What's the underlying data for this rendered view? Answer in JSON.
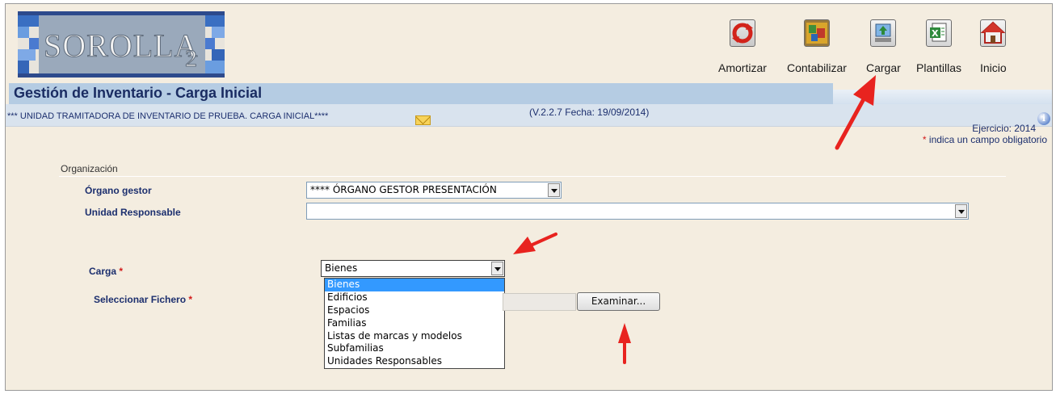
{
  "logo": {
    "text": "SOROLLA",
    "subscript": "2"
  },
  "toolbar": {
    "items": [
      {
        "label": "Amortizar",
        "icon": "refresh-icon"
      },
      {
        "label": "Contabilizar",
        "icon": "accounting-icon"
      },
      {
        "label": "Cargar",
        "icon": "upload-icon"
      },
      {
        "label": "Plantillas",
        "icon": "excel-template-icon"
      },
      {
        "label": "Inicio",
        "icon": "home-icon"
      }
    ]
  },
  "header": {
    "title": "Gestión de Inventario - Carga Inicial",
    "unit": "*** UNIDAD TRAMITADORA DE INVENTARIO DE PRUEBA. CARGA INICIAL****",
    "version": "(V.2.2.7 Fecha: 19/09/2014)",
    "ejercicio": "Ejercicio: 2014",
    "required_star": "*",
    "required_note": " indica un campo obligatorio"
  },
  "form": {
    "section_title": "Organización",
    "organo_gestor": {
      "label": "Órgano gestor",
      "value": "**** ÓRGANO GESTOR PRESENTACIÓN"
    },
    "unidad_responsable": {
      "label": "Unidad Responsable",
      "value": ""
    },
    "carga": {
      "label": "Carga",
      "required_star": "*",
      "value": "Bienes",
      "options": [
        "Bienes",
        "Edificios",
        "Espacios",
        "Familias",
        "Listas de marcas y modelos",
        "Subfamilias",
        "Unidades Responsables"
      ]
    },
    "fichero": {
      "label": "Seleccionar Fichero",
      "required_star": "*",
      "button_label": "Examinar..."
    }
  },
  "colors": {
    "background": "#f4ede0",
    "title_bar": "#b5cce3",
    "accent_text": "#1c2f6e",
    "selected_option": "#3399ff",
    "annotation_arrow": "#e8231f"
  }
}
